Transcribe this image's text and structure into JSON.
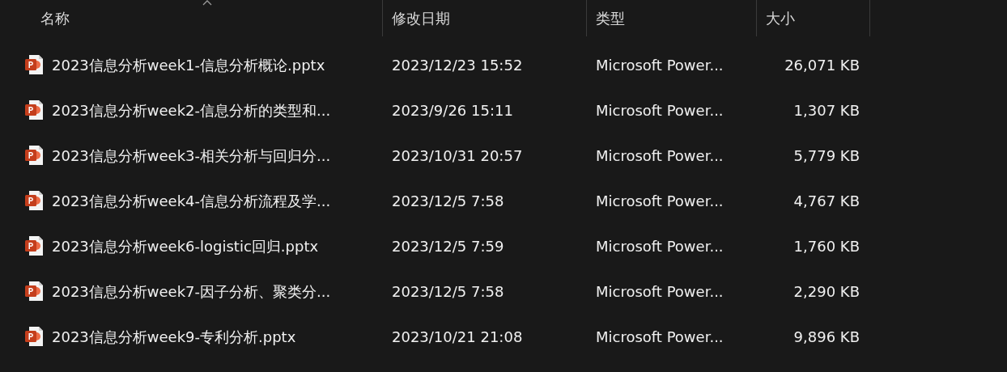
{
  "columns": [
    {
      "label": "名称",
      "sorted": true
    },
    {
      "label": "修改日期",
      "sorted": false
    },
    {
      "label": "类型",
      "sorted": false
    },
    {
      "label": "大小",
      "sorted": false
    }
  ],
  "files": [
    {
      "name": "2023信息分析week1-信息分析概论.pptx",
      "modified": "2023/12/23 15:52",
      "type": "Microsoft Power...",
      "size": "26,071 KB"
    },
    {
      "name": "2023信息分析week2-信息分析的类型和...",
      "modified": "2023/9/26 15:11",
      "type": "Microsoft Power...",
      "size": "1,307 KB"
    },
    {
      "name": "2023信息分析week3-相关分析与回归分...",
      "modified": "2023/10/31 20:57",
      "type": "Microsoft Power...",
      "size": "5,779 KB"
    },
    {
      "name": "2023信息分析week4-信息分析流程及学...",
      "modified": "2023/12/5 7:58",
      "type": "Microsoft Power...",
      "size": "4,767 KB"
    },
    {
      "name": "2023信息分析week6-logistic回归.pptx",
      "modified": "2023/12/5 7:59",
      "type": "Microsoft Power...",
      "size": "1,760 KB"
    },
    {
      "name": "2023信息分析week7-因子分析、聚类分...",
      "modified": "2023/12/5 7:58",
      "type": "Microsoft Power...",
      "size": "2,290 KB"
    },
    {
      "name": "2023信息分析week9-专利分析.pptx",
      "modified": "2023/10/21 21:08",
      "type": "Microsoft Power...",
      "size": "9,896 KB"
    }
  ]
}
